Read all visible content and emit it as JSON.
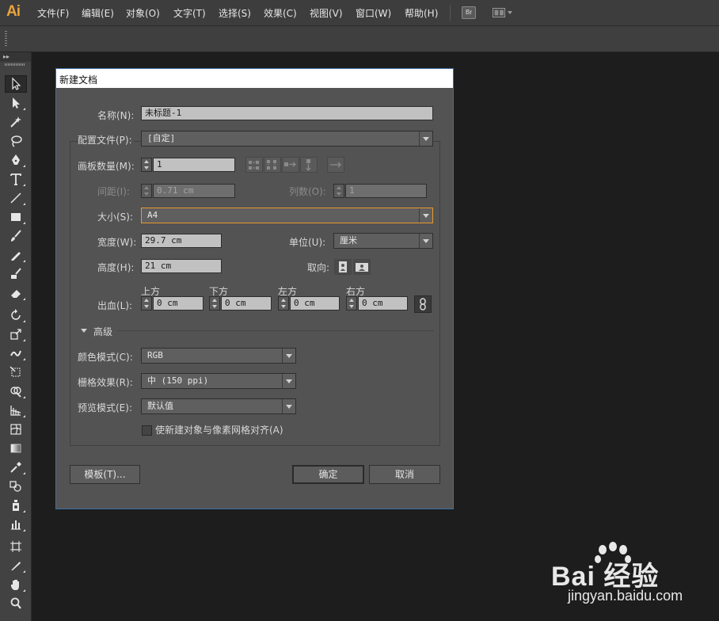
{
  "app": {
    "logo": "Ai"
  },
  "menubar": {
    "items": [
      "文件(F)",
      "编辑(E)",
      "对象(O)",
      "文字(T)",
      "选择(S)",
      "效果(C)",
      "视图(V)",
      "窗口(W)",
      "帮助(H)"
    ],
    "bridge_label": "Br"
  },
  "dialog": {
    "title": "新建文档",
    "name_label": "名称(N):",
    "name_value": "未标题-1",
    "profile_label": "配置文件(P):",
    "profile_value": "[自定]",
    "artboards_label": "画板数量(M):",
    "artboards_value": "1",
    "spacing_label": "间距(I):",
    "spacing_value": "0.71 cm",
    "columns_label": "列数(O):",
    "columns_value": "1",
    "size_label": "大小(S):",
    "size_value": "A4",
    "width_label": "宽度(W):",
    "width_value": "29.7 cm",
    "units_label": "单位(U):",
    "units_value": "厘米",
    "height_label": "高度(H):",
    "height_value": "21 cm",
    "orientation_label": "取向:",
    "bleed_label": "出血(L):",
    "bleed_top_label": "上方",
    "bleed_top_value": "0 cm",
    "bleed_bottom_label": "下方",
    "bleed_bottom_value": "0 cm",
    "bleed_left_label": "左方",
    "bleed_left_value": "0 cm",
    "bleed_right_label": "右方",
    "bleed_right_value": "0 cm",
    "advanced_label": "高级",
    "color_mode_label": "颜色模式(C):",
    "color_mode_value": "RGB",
    "raster_label": "栅格效果(R):",
    "raster_value": "中 (150 ppi)",
    "preview_label": "预览模式(E):",
    "preview_value": "默认值",
    "pixel_align_label": "使新建对象与像素网格对齐(A)",
    "pixel_align_checked": false,
    "templates_button": "模板(T)...",
    "ok_button": "确定",
    "cancel_button": "取消"
  },
  "watermark": {
    "logo_text": "Bai 经验",
    "url": "jingyan.baidu.com"
  },
  "colors": {
    "accent_focus": "#e89a2c",
    "logo": "#e8a33d",
    "dialog_border": "#3c6fa8"
  }
}
